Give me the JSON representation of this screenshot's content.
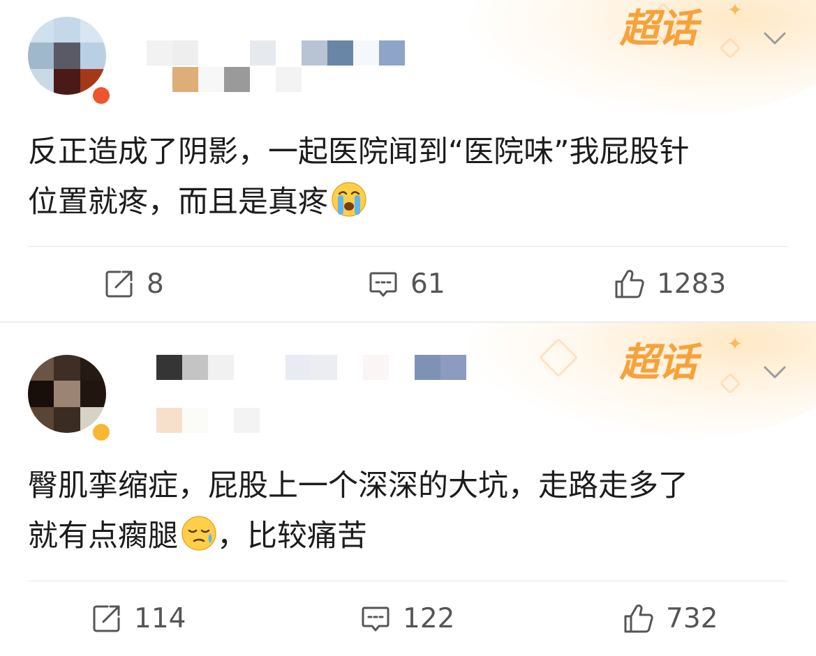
{
  "feed": {
    "posts": [
      {
        "tag": "超话",
        "text_line1": "反正造成了阴影，一起医院闻到“医院味”我屁股针",
        "text_line2": "位置就疼，而且是真疼",
        "emoji": "crying-face-icon",
        "actions": {
          "repost_count": "8",
          "comment_count": "61",
          "like_count": "1283"
        }
      },
      {
        "tag": "超话",
        "text_line1": "臀肌挛缩症，屁股上一个深深的大坑，走路走多了",
        "text_line2_before": "就有点瘸腿",
        "text_line2_after": "，比较痛苦",
        "emoji": "sad-relieved-face-icon",
        "actions": {
          "repost_count": "114",
          "comment_count": "122",
          "like_count": "732"
        }
      }
    ]
  },
  "colors": {
    "tag": "#f5a23a",
    "icon": "#555555",
    "text": "#1c1c1c",
    "divider": "#e6e6e6"
  }
}
